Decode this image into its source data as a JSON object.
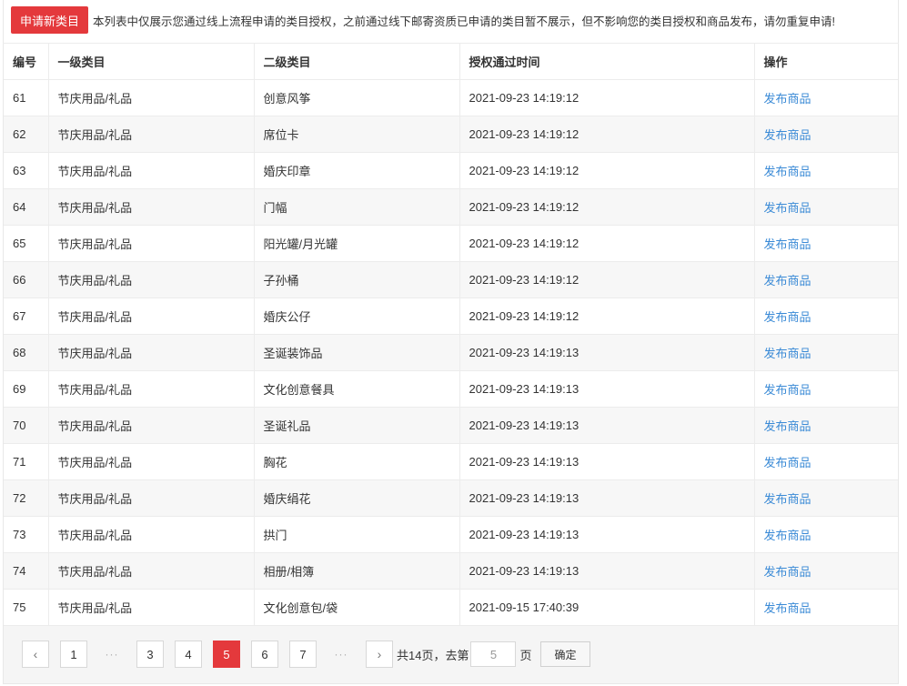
{
  "header": {
    "apply_button": "申请新类目",
    "notice": "本列表中仅展示您通过线上流程申请的类目授权，之前通过线下邮寄资质已申请的类目暂不展示，但不影响您的类目授权和商品发布，请勿重复申请!"
  },
  "table": {
    "columns": [
      "编号",
      "一级类目",
      "二级类目",
      "授权通过时间",
      "操作"
    ],
    "rows": [
      {
        "id": "61",
        "cat1": "节庆用品/礼品",
        "cat2": "创意风筝",
        "time": "2021-09-23 14:19:12",
        "action": "发布商品"
      },
      {
        "id": "62",
        "cat1": "节庆用品/礼品",
        "cat2": "席位卡",
        "time": "2021-09-23 14:19:12",
        "action": "发布商品"
      },
      {
        "id": "63",
        "cat1": "节庆用品/礼品",
        "cat2": "婚庆印章",
        "time": "2021-09-23 14:19:12",
        "action": "发布商品"
      },
      {
        "id": "64",
        "cat1": "节庆用品/礼品",
        "cat2": "门幅",
        "time": "2021-09-23 14:19:12",
        "action": "发布商品"
      },
      {
        "id": "65",
        "cat1": "节庆用品/礼品",
        "cat2": "阳光罐/月光罐",
        "time": "2021-09-23 14:19:12",
        "action": "发布商品"
      },
      {
        "id": "66",
        "cat1": "节庆用品/礼品",
        "cat2": "子孙桶",
        "time": "2021-09-23 14:19:12",
        "action": "发布商品"
      },
      {
        "id": "67",
        "cat1": "节庆用品/礼品",
        "cat2": "婚庆公仔",
        "time": "2021-09-23 14:19:12",
        "action": "发布商品"
      },
      {
        "id": "68",
        "cat1": "节庆用品/礼品",
        "cat2": "圣诞装饰品",
        "time": "2021-09-23 14:19:13",
        "action": "发布商品"
      },
      {
        "id": "69",
        "cat1": "节庆用品/礼品",
        "cat2": "文化创意餐具",
        "time": "2021-09-23 14:19:13",
        "action": "发布商品"
      },
      {
        "id": "70",
        "cat1": "节庆用品/礼品",
        "cat2": "圣诞礼品",
        "time": "2021-09-23 14:19:13",
        "action": "发布商品"
      },
      {
        "id": "71",
        "cat1": "节庆用品/礼品",
        "cat2": "胸花",
        "time": "2021-09-23 14:19:13",
        "action": "发布商品"
      },
      {
        "id": "72",
        "cat1": "节庆用品/礼品",
        "cat2": "婚庆绢花",
        "time": "2021-09-23 14:19:13",
        "action": "发布商品"
      },
      {
        "id": "73",
        "cat1": "节庆用品/礼品",
        "cat2": "拱门",
        "time": "2021-09-23 14:19:13",
        "action": "发布商品"
      },
      {
        "id": "74",
        "cat1": "节庆用品/礼品",
        "cat2": "相册/相簿",
        "time": "2021-09-23 14:19:13",
        "action": "发布商品"
      },
      {
        "id": "75",
        "cat1": "节庆用品/礼品",
        "cat2": "文化创意包/袋",
        "time": "2021-09-15 17:40:39",
        "action": "发布商品"
      }
    ]
  },
  "pagination": {
    "prev_icon": "‹",
    "next_icon": "›",
    "first": "1",
    "ellipsis": "···",
    "pages": [
      "3",
      "4",
      "5",
      "6",
      "7"
    ],
    "current": "5",
    "total_text": "共14页，去第",
    "goto_value": "5",
    "unit": "页",
    "confirm": "确定"
  },
  "colors": {
    "accent": "#e4393c",
    "link": "#3a8ad6"
  }
}
